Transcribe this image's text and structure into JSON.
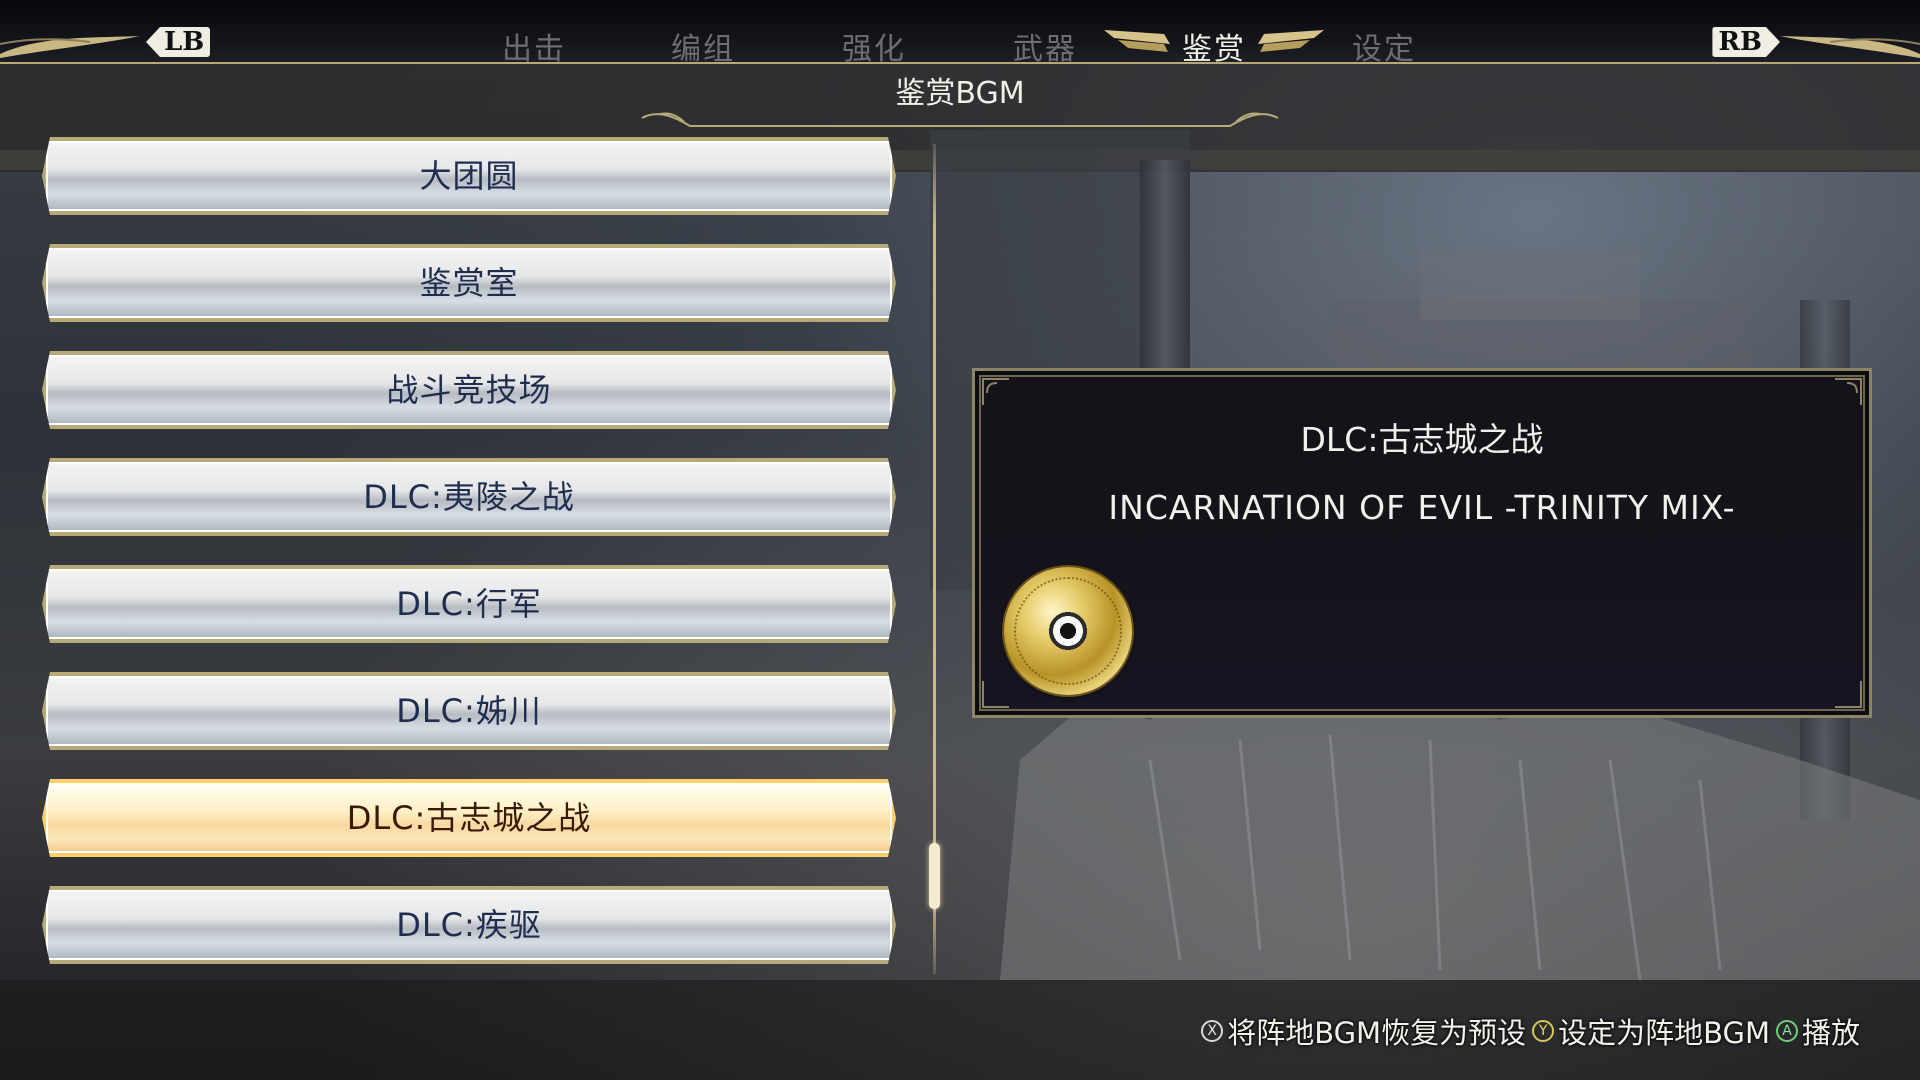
{
  "topbar": {
    "lb_label": "LB",
    "rb_label": "RB",
    "tabs": [
      {
        "label": "出击",
        "active": false
      },
      {
        "label": "编组",
        "active": false
      },
      {
        "label": "强化",
        "active": false
      },
      {
        "label": "武器",
        "active": false
      },
      {
        "label": "鉴赏",
        "active": true
      },
      {
        "label": "设定",
        "active": false
      }
    ]
  },
  "section": {
    "title": "鉴赏BGM"
  },
  "list": {
    "items": [
      {
        "label": "大团圆",
        "selected": false
      },
      {
        "label": "鉴赏室",
        "selected": false
      },
      {
        "label": "战斗竞技场",
        "selected": false
      },
      {
        "label": "DLC:夷陵之战",
        "selected": false
      },
      {
        "label": "DLC:行军",
        "selected": false
      },
      {
        "label": "DLC:姊川",
        "selected": false
      },
      {
        "label": "DLC:古志城之战",
        "selected": true
      },
      {
        "label": "DLC:疾驱",
        "selected": false
      }
    ]
  },
  "detail": {
    "stage": "DLC:古志城之战",
    "song": "INCARNATION OF EVIL -TRINITY MIX-",
    "icon": "music-disc-icon"
  },
  "hints": {
    "reset": {
      "button": "X",
      "label": "将阵地BGM恢复为预设"
    },
    "set": {
      "button": "Y",
      "label": "设定为阵地BGM"
    },
    "play": {
      "button": "A",
      "label": "播放"
    }
  },
  "colors": {
    "accent_gold": "#b8a978",
    "selected_glow": "#e06b1e",
    "list_text": "#1f2d4f"
  }
}
